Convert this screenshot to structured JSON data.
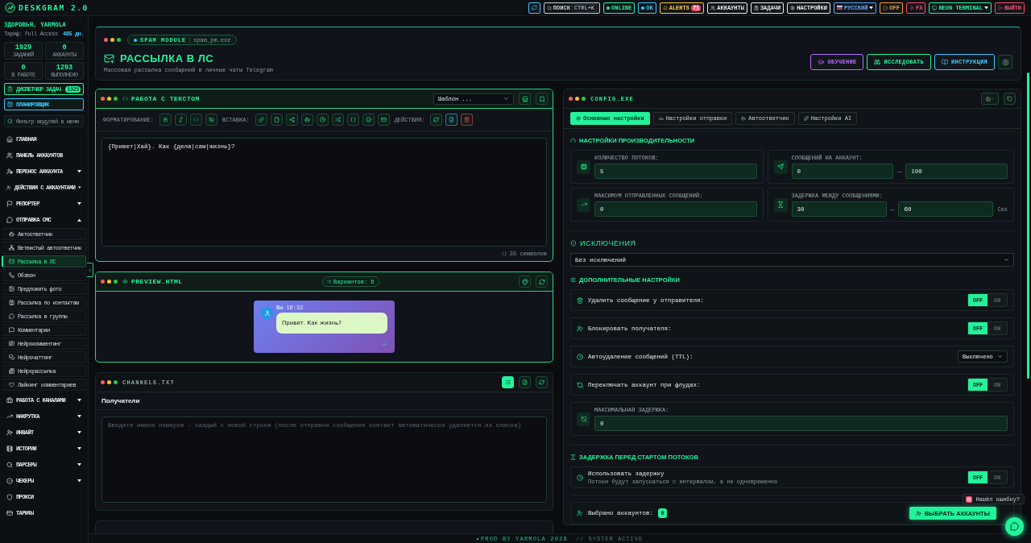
{
  "topbar": {
    "logo": "DESKGRAM 2.0",
    "items": [
      {
        "kind": "icon",
        "color": "#3ec8ff"
      },
      {
        "kind": "search",
        "label": "ПОИСК",
        "shortcut": "CTRL+K",
        "color": "#c8d0d4"
      },
      {
        "kind": "status",
        "label": "ONLINE",
        "color": "#22f29a"
      },
      {
        "kind": "status",
        "label": "OK",
        "color": "#3ec8ff"
      },
      {
        "kind": "alerts",
        "label": "ALERTS",
        "count": "71",
        "color": "#ffc83d"
      },
      {
        "kind": "link",
        "label": "АККАУНТЫ",
        "color": "#e6ecee"
      },
      {
        "kind": "link",
        "label": "ЗАДАЧИ",
        "color": "#e6ecee"
      },
      {
        "kind": "link",
        "label": "НАСТРОЙКИ",
        "color": "#e6ecee"
      },
      {
        "kind": "menu",
        "label": "РУССКИЙ",
        "color": "#5aa8ff"
      },
      {
        "kind": "link",
        "label": "OFF",
        "color": "#ff9f2e"
      },
      {
        "kind": "link",
        "label": "FX",
        "color": "#ff4d6a"
      },
      {
        "kind": "menu",
        "label": "NEON TERMINAL",
        "color": "#22f29a"
      },
      {
        "kind": "link",
        "label": "ВЫЙТИ",
        "color": "#ff4d6a"
      }
    ]
  },
  "sidebar": {
    "greeting": "ЗДОРОВЬЯ, YARMOLA",
    "plan": "Тариф: Full Access",
    "days": "485 дн.",
    "stats": [
      {
        "value": "1929",
        "label": "ЗАДАНИЙ"
      },
      {
        "value": "0",
        "label": "АККАУНТЫ"
      },
      {
        "value": "0",
        "label": "В РАБОТЕ"
      },
      {
        "value": "1293",
        "label": "ВЫПОЛНЕНО"
      }
    ],
    "task_manager": {
      "label": "ДИСПЕТЧЕР ЗАДАЧ",
      "count": "1929"
    },
    "scheduler": "ПЛАНИРОВЩИК",
    "filter": {
      "placeholder": "Фильтр модулей в меню"
    },
    "menu": [
      {
        "kind": "link",
        "label": "ГЛАВНАЯ"
      },
      {
        "kind": "link",
        "label": "ПАНЕЛЬ АККАУНТОВ"
      },
      {
        "kind": "group",
        "label": "ПЕРЕНОС АККАУНТА",
        "expanded": false
      },
      {
        "kind": "group",
        "label": "ДЕЙСТВИЯ С АККАУНТАМИ",
        "expanded": false
      },
      {
        "kind": "group",
        "label": "РЕПОРТЕР",
        "expanded": false
      },
      {
        "kind": "group",
        "label": "ОТПРАВКА СМС",
        "expanded": true,
        "children": [
          {
            "label": "Автоответчик",
            "selected": false
          },
          {
            "label": "Ветвистый автоответчик",
            "selected": false
          },
          {
            "label": "Рассылка в ЛС",
            "selected": true
          },
          {
            "label": "Обзвон",
            "selected": false
          },
          {
            "label": "Предложить фото",
            "selected": false
          },
          {
            "label": "Рассылка по контактам",
            "selected": false
          },
          {
            "label": "Рассылка в группы",
            "selected": false
          },
          {
            "label": "Комментарии",
            "selected": false
          },
          {
            "label": "Нейрокомментинг",
            "selected": false
          },
          {
            "label": "Нейрочаттинг",
            "selected": false
          },
          {
            "label": "Нейрорассылка",
            "selected": false
          },
          {
            "label": "Лайкинг комментариев",
            "selected": false
          }
        ]
      },
      {
        "kind": "group",
        "label": "РАБОТА С КАНАЛАМИ",
        "expanded": false
      },
      {
        "kind": "group",
        "label": "НАКРУТКА",
        "expanded": false
      },
      {
        "kind": "group",
        "label": "ИНВАЙТ",
        "expanded": false
      },
      {
        "kind": "group",
        "label": "ИСТОРИИ",
        "expanded": false
      },
      {
        "kind": "group",
        "label": "ПАРСЕРЫ",
        "expanded": false
      },
      {
        "kind": "group",
        "label": "ЧЕКЕРЫ",
        "expanded": false
      },
      {
        "kind": "link",
        "label": "ПРОКСИ"
      },
      {
        "kind": "link",
        "label": "ТАРИФЫ"
      }
    ]
  },
  "header": {
    "module": "SPAM MODULE",
    "file": "spam_pm.exe",
    "title": "РАССЫЛКА В ЛС",
    "subtitle": "Массовая рассылка сообщений в личные чаты Telegram",
    "buttons": [
      {
        "label": "ОБУЧЕНИЕ",
        "color": "#b36bff"
      },
      {
        "label": "ИССЛЕДОВАТЬ",
        "color": "#22f29a"
      },
      {
        "label": "ИНСТРУКЦИЯ",
        "color": "#3ec8ff"
      }
    ]
  },
  "editor": {
    "title": "РАБОТА С ТЕКСТОМ",
    "template": "Шаблон ...",
    "groups": [
      {
        "label": "ФОРМАТИРОВАНИЕ:"
      },
      {
        "label": "ВСТАВКА:"
      },
      {
        "label": "ДЕЙСТВИЯ:"
      }
    ],
    "text": "{Привет|Хай}. Как {дела|сам|жизнь}?",
    "counter": "35 символов"
  },
  "preview": {
    "title": "PREVIEW.HTML",
    "variants": "Вариантов: 6",
    "sender": "Вы",
    "time": "18:32",
    "message": "Привет. Как жизнь?"
  },
  "channels": {
    "title": "CHANNELS.TXT",
    "section": "Получатели",
    "placeholder": "Введите имена номеров - каждый с новой строки (после отправки сообщения контакт автоматически удаляется из списка)"
  },
  "config": {
    "title": "CONFIG.EXE",
    "tabs": [
      {
        "label": "Основные настройки",
        "selected": true
      },
      {
        "label": "Настройки отправки",
        "selected": false
      },
      {
        "label": "Автоответчик",
        "selected": false
      },
      {
        "label": "Настройки AI",
        "selected": false
      }
    ],
    "performance": {
      "title": "НАСТРОЙКИ ПРОИЗВОДИТЕЛЬНОСТИ",
      "fields": [
        {
          "label": "КОЛИЧЕСТВО ПОТОКОВ:",
          "values": [
            "5"
          ]
        },
        {
          "label": "СООБЩЕНИЙ НА АККАУНТ:",
          "values": [
            "0",
            "100"
          ],
          "separator": "—"
        },
        {
          "label": "МАКСИМУМ ОТПРАВЛЕННЫХ СООБЩЕНИЙ:",
          "values": [
            "0"
          ]
        },
        {
          "label": "ЗАДЕРЖКА МЕЖДУ СООБЩЕНИЯМИ:",
          "values": [
            "30",
            "60"
          ],
          "separator": "—",
          "unit": "Сек"
        }
      ]
    },
    "exclusions": {
      "title": "ИСКЛЮЧЕНИЯ",
      "value": "Без исключений"
    },
    "extra": {
      "title": "ДОПОЛНИТЕЛЬНЫЕ НАСТРОЙКИ",
      "rows": [
        {
          "kind": "toggle",
          "label": "Удалить сообщение у отправителя:",
          "on": false,
          "off_label": "OFF",
          "on_label": "ON"
        },
        {
          "kind": "toggle",
          "label": "Блокировать получателя:",
          "on": false,
          "off_label": "OFF",
          "on_label": "ON"
        },
        {
          "kind": "select",
          "label": "Автоудаление сообщений (TTL):",
          "value": "Выключено"
        },
        {
          "kind": "toggle",
          "label": "Переключать аккаунт при флудах:",
          "on": false,
          "off_label": "OFF",
          "on_label": "ON"
        },
        {
          "kind": "field",
          "label": "МАКСИМАЛЬНАЯ ЗАДЕРЖКА:",
          "value": "0"
        }
      ]
    },
    "start_delay": {
      "title": "ЗАДЕРЖКА ПЕРЕД СТАРТОМ ПОТОКОВ",
      "rows": [
        {
          "kind": "toggle",
          "label": "Использовать задержку",
          "description": "Потоки будут запускаться с интервалом, а не одновременно",
          "on": false,
          "off_label": "OFF",
          "on_label": "ON"
        }
      ]
    },
    "accounts": {
      "label": "Выбрано аккаунтов:",
      "count": "0",
      "button": "ВЫБРАТЬ АККАУНТЫ"
    }
  },
  "bug_report": "Нашёл ошибку?",
  "footer": {
    "credit": "PROD BY YARMOLA 2026",
    "status": "// SYSTEM ACTIVE"
  }
}
